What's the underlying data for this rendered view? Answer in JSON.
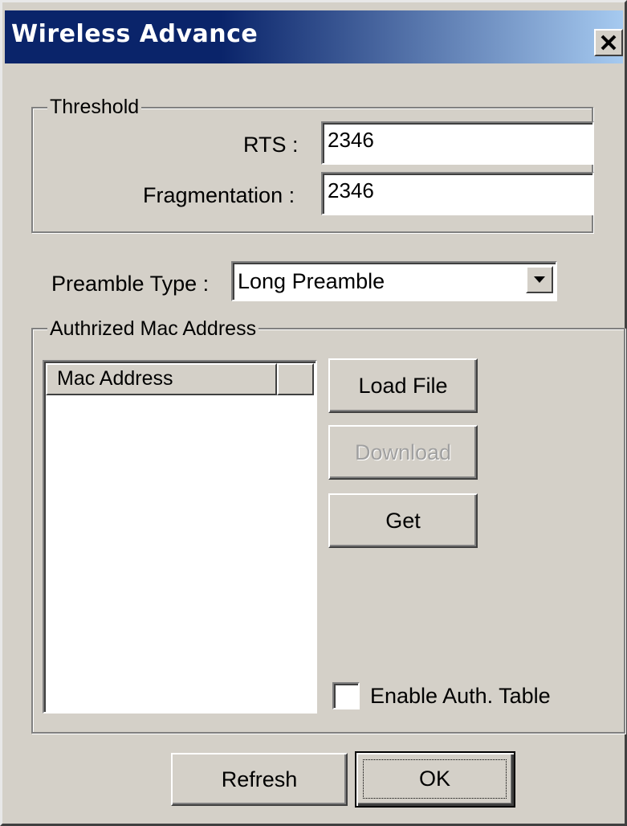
{
  "window": {
    "title": "Wireless Advance",
    "close_icon": "close-icon"
  },
  "threshold": {
    "legend": "Threshold",
    "rts_label": "RTS :",
    "rts_value": "2346",
    "fragmentation_label": "Fragmentation :",
    "fragmentation_value": "2346"
  },
  "preamble": {
    "label": "Preamble Type :",
    "selected": "Long Preamble",
    "arrow_icon": "chevron-down-icon"
  },
  "auth_mac": {
    "legend": "Authrized Mac Address",
    "column_header": "Mac Address",
    "rows": [],
    "load_file_label": "Load File",
    "download_label": "Download",
    "get_label": "Get",
    "enable_table_label": "Enable Auth. Table",
    "enable_table_checked": false
  },
  "footer": {
    "refresh_label": "Refresh",
    "ok_label": "OK"
  }
}
